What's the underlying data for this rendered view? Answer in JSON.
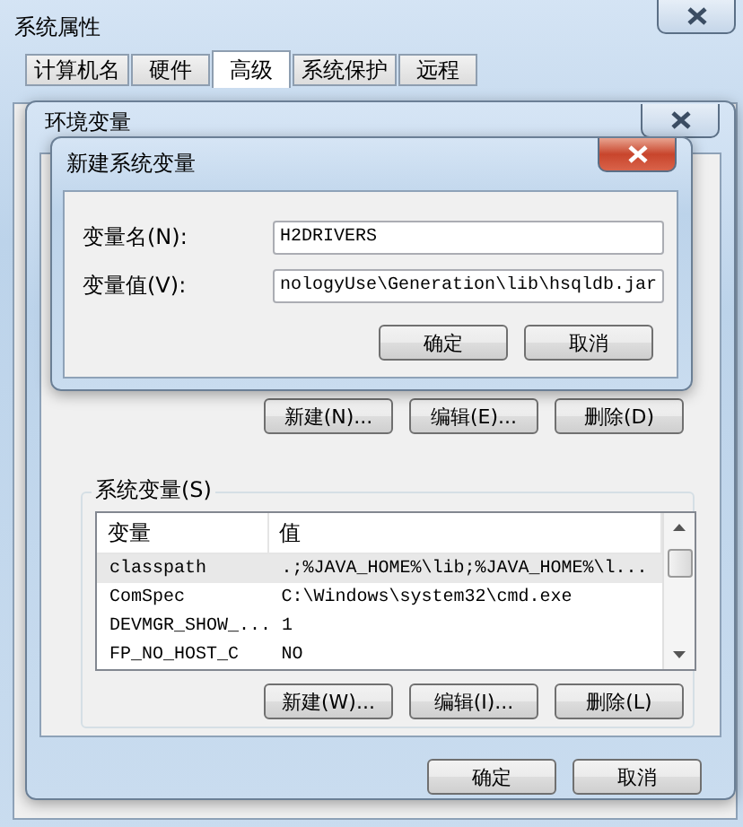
{
  "window": {
    "title": "系统属性"
  },
  "tabs": [
    {
      "label": "计算机名",
      "selected": false
    },
    {
      "label": "硬件",
      "selected": false
    },
    {
      "label": "高级",
      "selected": true
    },
    {
      "label": "系统保护",
      "selected": false
    },
    {
      "label": "远程",
      "selected": false
    }
  ],
  "env_window": {
    "title": "环境变量",
    "user_buttons": [
      "新建(N)...",
      "编辑(E)...",
      "删除(D)"
    ],
    "system_group": {
      "label": "系统变量(S)",
      "columns": [
        "变量",
        "值"
      ],
      "rows": [
        {
          "name": "classpath",
          "value": ".;%JAVA_HOME%\\lib;%JAVA_HOME%\\l...",
          "selected": true
        },
        {
          "name": "ComSpec",
          "value": "C:\\Windows\\system32\\cmd.exe",
          "selected": false
        },
        {
          "name": "DEVMGR_SHOW_...",
          "value": "1",
          "selected": false
        },
        {
          "name": "FP_NO_HOST_C",
          "value": "NO",
          "selected": false
        }
      ],
      "buttons": [
        "新建(W)...",
        "编辑(I)...",
        "删除(L)"
      ]
    },
    "buttons": [
      "确定",
      "取消"
    ]
  },
  "dialog": {
    "title": "新建系统变量",
    "fields": [
      {
        "label": "变量名(N):",
        "value": "H2DRIVERS"
      },
      {
        "label": "变量值(V):",
        "value": "nologyUse\\Generation\\lib\\hsqldb.jar"
      }
    ],
    "buttons": [
      "确定",
      "取消"
    ]
  }
}
